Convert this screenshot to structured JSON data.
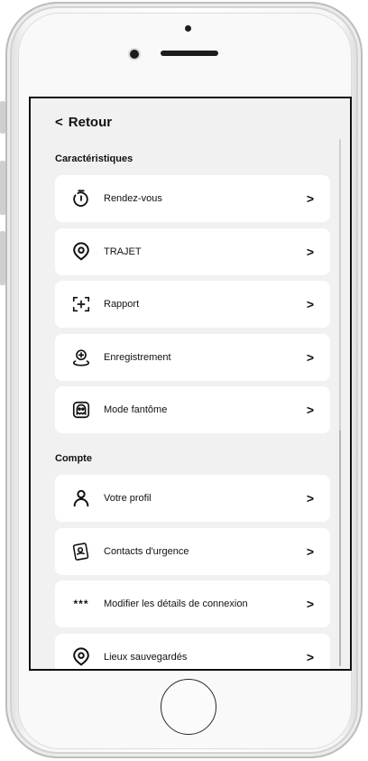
{
  "nav": {
    "back_label": "Retour"
  },
  "sections": {
    "features_title": "Caractéristiques",
    "account_title": "Compte"
  },
  "features": [
    {
      "label": "Rendez-vous",
      "icon": "timer-icon"
    },
    {
      "label": "TRAJET",
      "icon": "location-pin-icon"
    },
    {
      "label": "Rapport",
      "icon": "report-add-icon"
    },
    {
      "label": "Enregistrement",
      "icon": "check-in-pin-icon"
    },
    {
      "label": "Mode fantôme",
      "icon": "ghost-icon"
    }
  ],
  "account": [
    {
      "label": "Votre profil",
      "icon": "user-icon"
    },
    {
      "label": "Contacts d'urgence",
      "icon": "contacts-icon"
    },
    {
      "label": "Modifier les détails de connexion",
      "icon": "password-icon",
      "glyph": "***"
    },
    {
      "label": "Lieux sauvegardés",
      "icon": "saved-place-icon"
    }
  ],
  "colors": {
    "screen_bg": "#f1f1f1",
    "card_bg": "#ffffff",
    "text": "#111111"
  }
}
